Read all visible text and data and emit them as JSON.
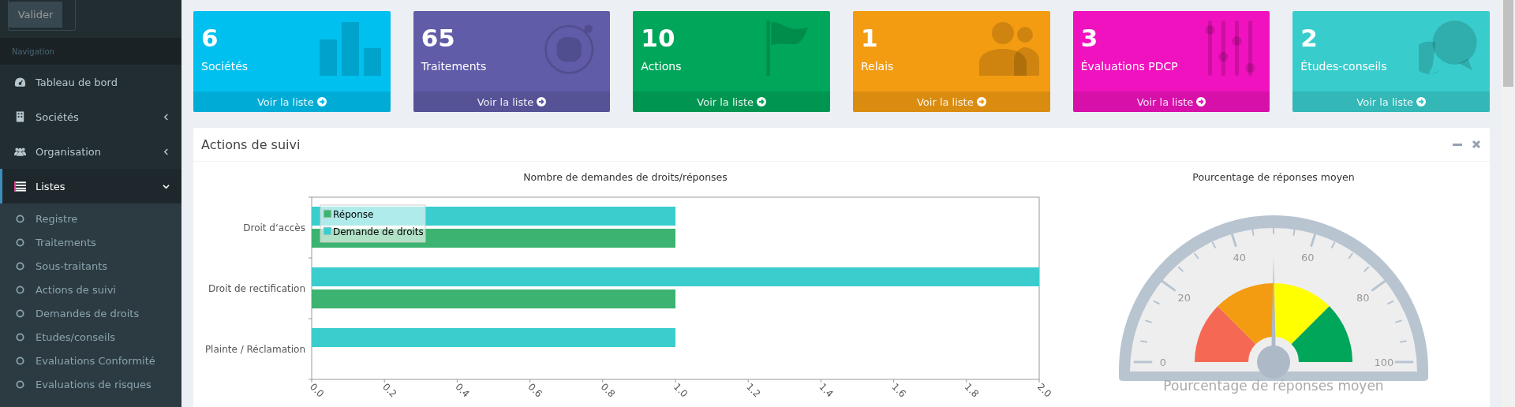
{
  "sidebar": {
    "submit_button": "Valider",
    "header": "Navigation",
    "items": [
      {
        "label": "Tableau de bord",
        "kind": "link",
        "selected": false
      },
      {
        "label": "Sociétés",
        "kind": "menu",
        "expanded": false,
        "selected": false
      },
      {
        "label": "Organisation",
        "kind": "menu",
        "expanded": false,
        "selected": false
      },
      {
        "label": "Listes",
        "kind": "menu",
        "expanded": true,
        "selected": true,
        "children": [
          {
            "label": "Registre"
          },
          {
            "label": "Traitements"
          },
          {
            "label": "Sous-traitants"
          },
          {
            "label": "Actions de suivi"
          },
          {
            "label": "Demandes de droits"
          },
          {
            "label": "Etudes/conseils"
          },
          {
            "label": "Evaluations Conformité"
          },
          {
            "label": "Evaluations de risques"
          }
        ]
      }
    ]
  },
  "info_boxes": [
    {
      "count": "6",
      "label": "Sociétés",
      "link": "Voir la liste",
      "color": "#00c0ef"
    },
    {
      "count": "65",
      "label": "Traitements",
      "link": "Voir la liste",
      "color": "#605ca8"
    },
    {
      "count": "10",
      "label": "Actions",
      "link": "Voir la liste",
      "color": "#00a65a"
    },
    {
      "count": "1",
      "label": "Relais",
      "link": "Voir la liste",
      "color": "#f39c12"
    },
    {
      "count": "3",
      "label": "Évaluations PDCP",
      "link": "Voir la liste",
      "color": "#f012be"
    },
    {
      "count": "2",
      "label": "Études-conseils",
      "link": "Voir la liste",
      "color": "#39cccc"
    }
  ],
  "panel": {
    "title": "Actions de suivi",
    "bar_chart": {
      "chart_data": {
        "type": "bar",
        "orientation": "horizontal",
        "title": "Nombre de demandes de droits/réponses",
        "categories": [
          "Droit d‘accès",
          "Droit de rectification",
          "Plainte / Réclamation"
        ],
        "series": [
          {
            "name": "Réponse",
            "color": "#3cb371",
            "values": [
              1,
              1,
              0
            ]
          },
          {
            "name": "Demande de droits",
            "color": "#3bcdcd",
            "values": [
              1,
              2,
              1
            ]
          }
        ],
        "legend": "upper left",
        "xlim": [
          0,
          2
        ],
        "xticks": [
          {
            "value": 0,
            "label": "0.0"
          },
          {
            "value": 0.2,
            "label": "0.2"
          },
          {
            "value": 0.4,
            "label": "0.4"
          },
          {
            "value": 0.6,
            "label": "0.6"
          },
          {
            "value": 0.8,
            "label": "0.8"
          },
          {
            "value": 1,
            "label": "1.0"
          },
          {
            "value": 1.2,
            "label": "1.2"
          },
          {
            "value": 1.4,
            "label": "1.4"
          },
          {
            "value": 1.6,
            "label": "1.6"
          },
          {
            "value": 1.8,
            "label": "1.8"
          },
          {
            "value": 2,
            "label": "2.0"
          }
        ]
      }
    },
    "gauge": {
      "title": "Pourcentage de réponses moyen",
      "caption": "Pourcentage de réponses moyen",
      "tick_labels": [
        "0",
        "20",
        "40",
        "60",
        "80",
        "100"
      ],
      "bands": [
        {
          "color": "#f56954"
        },
        {
          "color": "#f39c12"
        },
        {
          "color": "#ffff00"
        },
        {
          "color": "#00a65a"
        }
      ]
    }
  }
}
